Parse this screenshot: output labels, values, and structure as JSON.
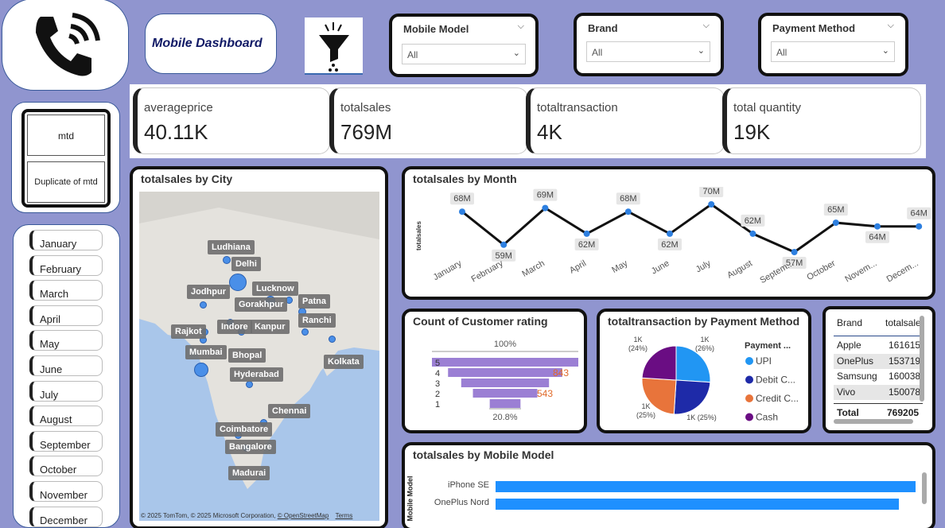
{
  "header": {
    "title": "Mobile Dashboard",
    "slicers": [
      {
        "label": "Mobile Model",
        "value": "All"
      },
      {
        "label": "Brand",
        "value": "All"
      },
      {
        "label": "Payment Method",
        "value": "All"
      }
    ]
  },
  "bookmarks": {
    "mtd": "mtd",
    "duplicate": "Duplicate of mtd"
  },
  "months": [
    "January",
    "February",
    "March",
    "April",
    "May",
    "June",
    "July",
    "August",
    "September",
    "October",
    "November",
    "December"
  ],
  "kpis": [
    {
      "label": "averageprice",
      "value": "40.11K"
    },
    {
      "label": "totalsales",
      "value": "769M"
    },
    {
      "label": "totaltransaction",
      "value": "4K"
    },
    {
      "label": "total quantity",
      "value": "19K"
    }
  ],
  "map": {
    "title": "totalsales by City",
    "cities": [
      "Ludhiana",
      "Delhi",
      "Lucknow",
      "Jodhpur",
      "Gorakhpur",
      "Patna",
      "Indore",
      "Kanpur",
      "Ranchi",
      "Rajkot",
      "Mumbai",
      "Bhopal",
      "Kolkata",
      "Hyderabad",
      "Chennai",
      "Coimbatore",
      "Bangalore",
      "Madurai"
    ],
    "copyright": "© 2025 TomTom, © 2025 Microsoft Corporation,",
    "osm": "© OpenStreetMap",
    "terms": "Terms"
  },
  "line": {
    "title": "totalsales by Month",
    "ylabel": "totalsales",
    "labels": [
      "68M",
      "59M",
      "69M",
      "62M",
      "68M",
      "62M",
      "70M",
      "62M",
      "57M",
      "65M",
      "64M",
      "64M"
    ],
    "xticks": [
      "January",
      "February",
      "March",
      "April",
      "May",
      "June",
      "July",
      "August",
      "Septem...",
      "October",
      "Novem...",
      "Decem..."
    ]
  },
  "funnel": {
    "title": "Count of Customer rating",
    "top": "100%",
    "bottom": "20.8%",
    "v843": "843",
    "v543": "543",
    "cats": [
      "5",
      "4",
      "3",
      "2",
      "1"
    ],
    "widths": [
      1,
      0.78,
      0.6,
      0.44,
      0.21
    ]
  },
  "pie": {
    "title": "totaltransaction by Payment Method",
    "legend_title": "Payment ...",
    "items": [
      {
        "name": "UPI",
        "color": "#2196f3"
      },
      {
        "name": "Debit C...",
        "color": "#1e2aa8"
      },
      {
        "name": "Credit C...",
        "color": "#e8743b"
      },
      {
        "name": "Cash",
        "color": "#6a0d83"
      }
    ],
    "labels": [
      {
        "a": "1K",
        "b": "(26%)"
      },
      {
        "a": "1K (25%)",
        "b": ""
      },
      {
        "a": "1K",
        "b": "(25%)"
      },
      {
        "a": "1K",
        "b": "(24%)"
      }
    ]
  },
  "table": {
    "headers": [
      "Brand",
      "totalsale"
    ],
    "rows": [
      [
        "Apple",
        "161615"
      ],
      [
        "OnePlus",
        "153719"
      ],
      [
        "Samsung",
        "160038"
      ],
      [
        "Vivo",
        "150078"
      ]
    ],
    "total": [
      "Total",
      "769205"
    ]
  },
  "bar": {
    "title": "totalsales by Mobile Model",
    "ylabel": "Mobile Model",
    "rows": [
      "iPhone SE",
      "OnePlus Nord"
    ],
    "fills": [
      1,
      0.96
    ]
  }
}
